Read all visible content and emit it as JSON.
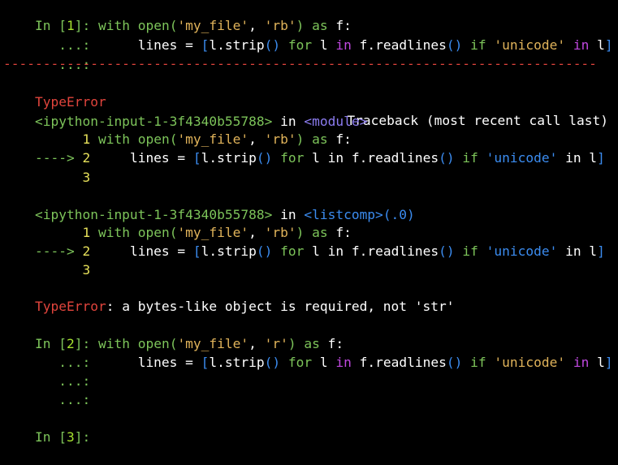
{
  "colors": {
    "background": "#000000",
    "default": "#ffffff",
    "prompt": "#7dc45a",
    "prompt_num": "#a6e22e",
    "keyword": "#7dc45a",
    "keyword_in": "#c048e0",
    "string": "#e0b35a",
    "builtin": "#7dc45a",
    "bracket": "#7dc45a",
    "operator": "#ffffff",
    "error": "#e0443c",
    "module": "#8c7cf0",
    "listcomp": "#3b8cf0",
    "arrow": "#7dc45a",
    "lineno": "#e6e05a",
    "method_paren": "#3b8cf0"
  },
  "in1": {
    "prompt": "In [",
    "num": "1",
    "prompt_end": "]: ",
    "line1": {
      "kw": "with",
      "sp1": " ",
      "fn": "open",
      "p1": "(",
      "s1": "'my_file'",
      "c": ", ",
      "s2": "'rb'",
      "p2": ")",
      "sp2": " ",
      "kw2": "as",
      "rest": " f:"
    },
    "cont": "   ...:",
    "line2": {
      "pre": "      lines = ",
      "b1": "[",
      "a": "l",
      "d1": ".",
      "m1": "strip",
      "pp1": "()",
      "sp1": " ",
      "kw": "for",
      "b": " l ",
      "kin": "in",
      "c": " f",
      "d2": ".",
      "m2": "readlines",
      "pp2": "()",
      "sp2": " ",
      "kif": "if",
      "sp3": " ",
      "s": "'unicode'",
      "sp4": " ",
      "kin2": "in",
      "e": " l",
      "b2": "]"
    },
    "cont2": "   ...:"
  },
  "rule": "---------------------------------------------------------------------------",
  "error1": {
    "name": "TypeError",
    "traceback": "Traceback (most recent call last)",
    "frame1_file": "<ipython-input-1-3f4340b55788>",
    "frame1_in": " in ",
    "frame1_module": "<module>",
    "frame2_file": "<ipython-input-1-3f4340b55788>",
    "frame2_in": " in ",
    "frame2_listcomp": "<listcomp>",
    "frame2_arg": "(.0)",
    "ln1": "1",
    "ln2": "2",
    "ln3": "3",
    "arrow": "---->",
    "msg": "a bytes-like object is required, not 'str'",
    "colon": ": "
  },
  "in2": {
    "prompt": "In [",
    "num": "2",
    "prompt_end": "]: ",
    "s2": "'r'",
    "cont": "   ...:"
  },
  "in3": {
    "prompt": "In [",
    "num": "3",
    "prompt_end": "]: "
  }
}
